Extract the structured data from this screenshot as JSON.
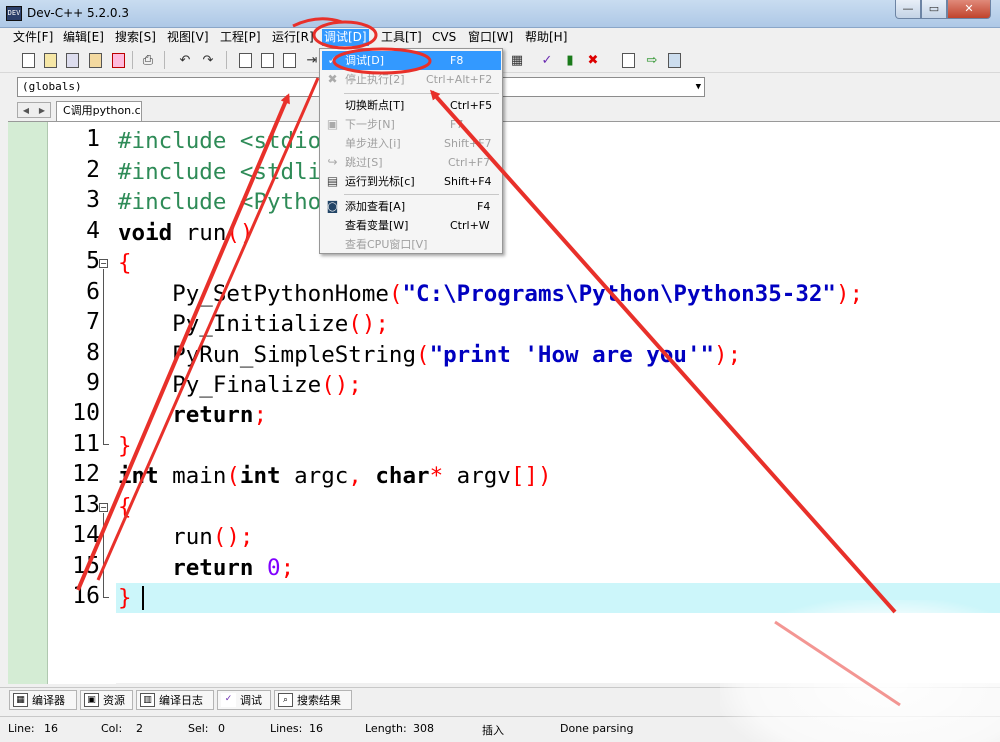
{
  "window": {
    "title": "Dev-C++ 5.2.0.3",
    "controls": {
      "minimize": "—",
      "maximize": "▭",
      "close": "✕"
    }
  },
  "menubar": [
    "文件[F]",
    "编辑[E]",
    "搜索[S]",
    "视图[V]",
    "工程[P]",
    "运行[R]",
    "调试[D]",
    "工具[T]",
    "CVS",
    "窗口[W]",
    "帮助[H]"
  ],
  "toolbar": {
    "icons": [
      "new-file-icon",
      "open-file-icon",
      "save-icon",
      "save-all-icon",
      "close-file-icon",
      "print-icon",
      "undo-icon",
      "redo-icon",
      "find-icon",
      "find-next-icon",
      "replace-icon",
      "indent-icon",
      "view-grid-icon",
      "check-icon",
      "chart-icon",
      "delete-icon",
      "step-out-icon",
      "insert-icon",
      "bookmark-icon"
    ]
  },
  "scope": {
    "selected": "(globals)"
  },
  "tabs": [
    {
      "label": "C调用python.c"
    }
  ],
  "editor": {
    "line_numbers": [
      "1",
      "2",
      "3",
      "4",
      "5",
      "6",
      "7",
      "8",
      "9",
      "10",
      "11",
      "12",
      "13",
      "14",
      "15",
      "16"
    ],
    "current_line": 16
  },
  "debug_menu": {
    "items": [
      {
        "label": "调试[D]",
        "shortcut": "F8",
        "state": "highlighted",
        "icon": "check-icon"
      },
      {
        "label": "停止执行[2]",
        "shortcut": "Ctrl+Alt+F2",
        "state": "disabled",
        "icon": "stop-icon"
      },
      {
        "label": "切换断点[T]",
        "shortcut": "Ctrl+F5",
        "state": "enabled",
        "icon": ""
      },
      {
        "label": "下一步[N]",
        "shortcut": "F7",
        "state": "disabled",
        "icon": "step-icon"
      },
      {
        "label": "单步进入[i]",
        "shortcut": "Shift+F7",
        "state": "disabled",
        "icon": ""
      },
      {
        "label": "跳过[S]",
        "shortcut": "Ctrl+F7",
        "state": "disabled",
        "icon": "skip-icon"
      },
      {
        "label": "运行到光标[c]",
        "shortcut": "Shift+F4",
        "state": "enabled",
        "icon": "run-to-cursor-icon"
      },
      {
        "label": "添加查看[A]",
        "shortcut": "F4",
        "state": "enabled",
        "icon": "add-watch-icon"
      },
      {
        "label": "查看变量[W]",
        "shortcut": "Ctrl+W",
        "state": "enabled",
        "icon": ""
      },
      {
        "label": "查看CPU窗口[V]",
        "shortcut": "",
        "state": "disabled",
        "icon": ""
      }
    ]
  },
  "bottom_tabs": [
    "编译器",
    "资源",
    "编译日志",
    "调试",
    "搜索结果"
  ],
  "status": {
    "line_label": "Line:",
    "line_value": "16",
    "col_label": "Col:",
    "col_value": "2",
    "sel_label": "Sel:",
    "sel_value": "0",
    "lines_label": "Lines:",
    "lines_value": "16",
    "length_label": "Length:",
    "length_value": "308",
    "mode": "插入",
    "message": "Done parsing"
  },
  "colors": {
    "menu_highlight": "#3399ff",
    "current_line": "#ccf6fa",
    "gutter": "#d4ecd4",
    "annotation_red": "#e8302a"
  }
}
